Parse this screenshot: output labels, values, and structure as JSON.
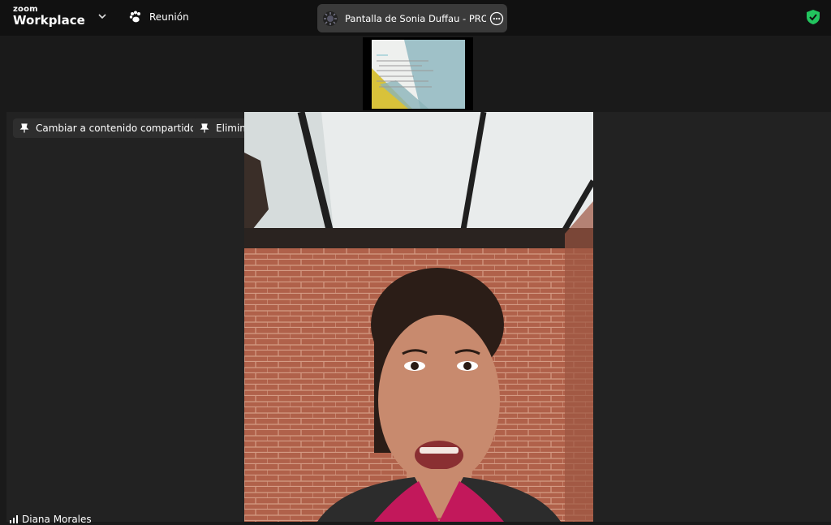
{
  "app": {
    "logo_line1": "zoom",
    "logo_line2": "Workplace"
  },
  "meeting": {
    "label": "Reunión"
  },
  "share": {
    "title": "Pantalla de Sonia Duffau - PROVO"
  },
  "toolbar": {
    "switch_label": "Cambiar a contenido compartido",
    "unpin_label": "Eliminar anclaje"
  },
  "participant": {
    "name": "Diana Morales"
  },
  "colors": {
    "topbar": "#111111",
    "pill": "#3a3a3a",
    "security_green": "#22c55e",
    "main_bg": "#222222"
  }
}
